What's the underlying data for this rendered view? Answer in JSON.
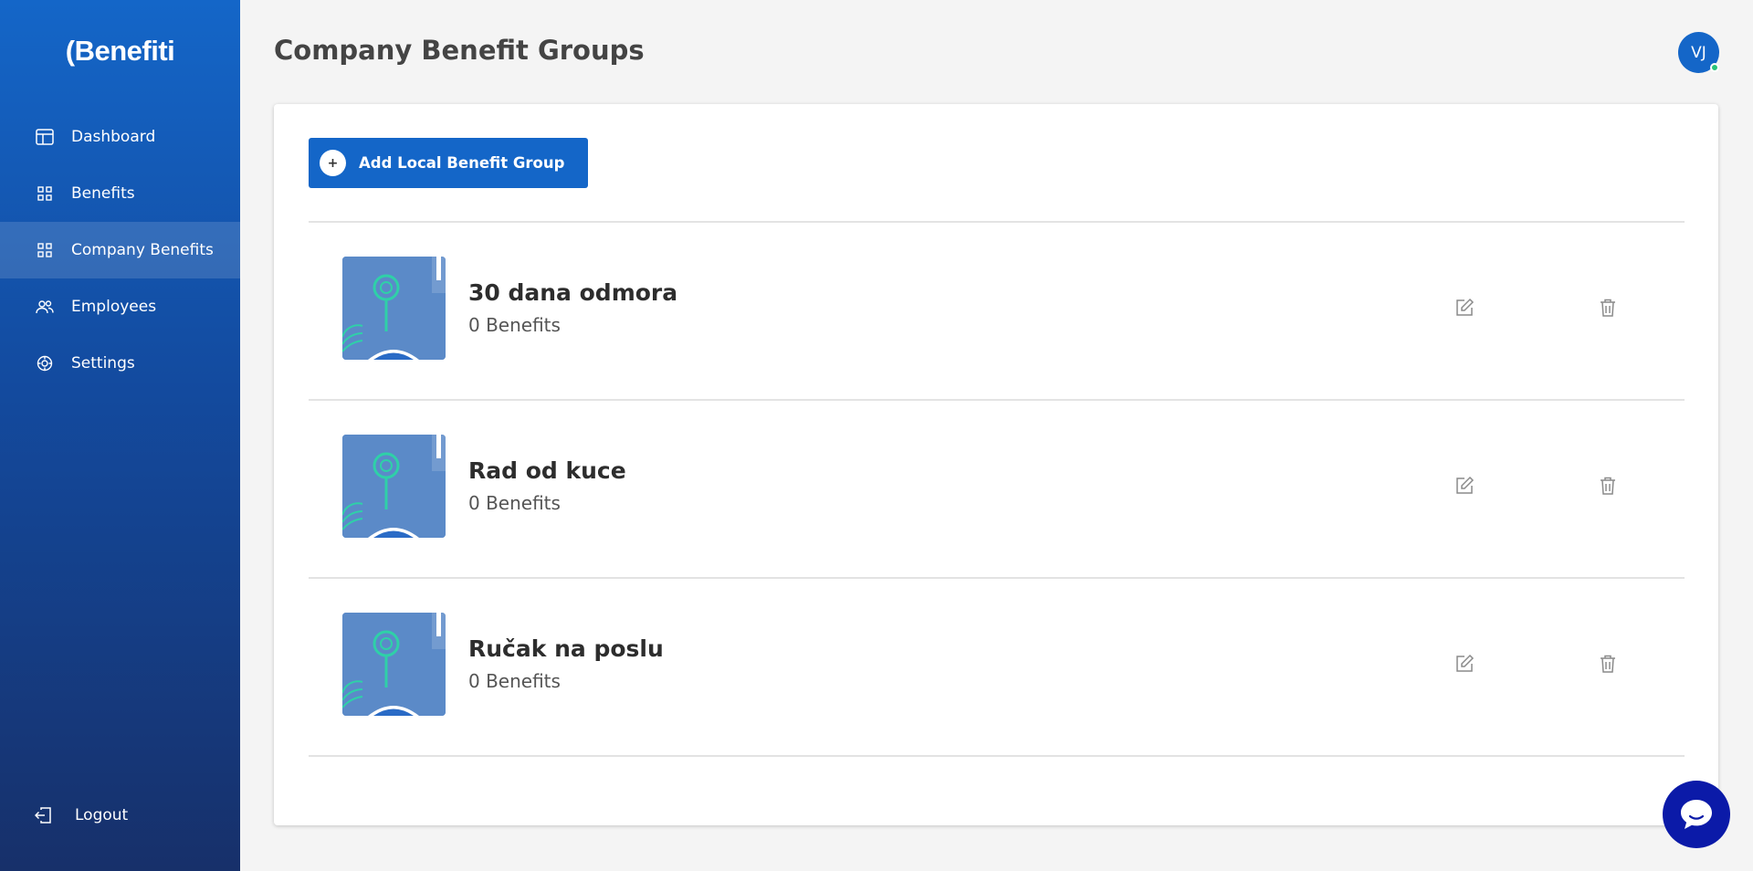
{
  "brand": {
    "logo_text": "(Benefiti",
    "accent": "#1466c8"
  },
  "sidebar": {
    "items": [
      {
        "label": "Dashboard",
        "icon": "dashboard-icon"
      },
      {
        "label": "Benefits",
        "icon": "grid-icon"
      },
      {
        "label": "Company Benefits",
        "icon": "grid-icon",
        "active": true
      },
      {
        "label": "Employees",
        "icon": "users-icon"
      },
      {
        "label": "Settings",
        "icon": "gear-icon"
      }
    ],
    "logout_label": "Logout"
  },
  "header": {
    "title": "Company Benefit Groups",
    "avatar_initials": "VJ"
  },
  "main": {
    "add_button_label": "Add Local Benefit Group",
    "add_button_icon": "+",
    "groups": [
      {
        "name": "30 dana odmora",
        "count": "0 Benefits"
      },
      {
        "name": "Rad od kuce",
        "count": "0 Benefits"
      },
      {
        "name": "Ručak na poslu",
        "count": "0 Benefits"
      }
    ]
  }
}
